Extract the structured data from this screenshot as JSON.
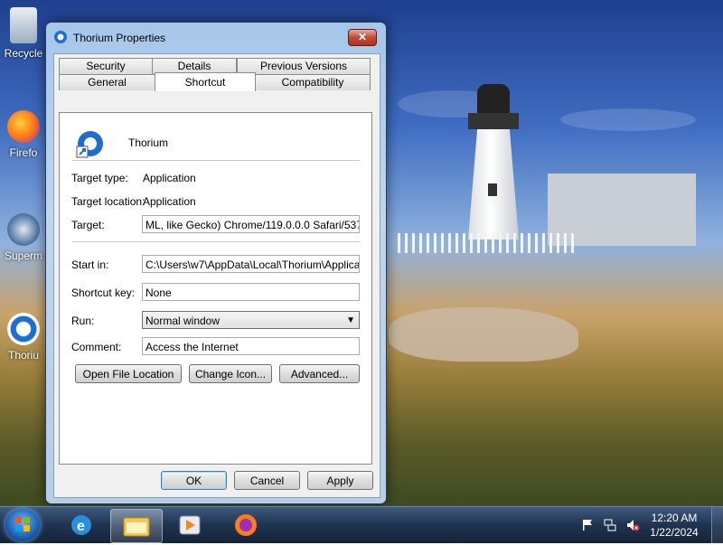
{
  "window": {
    "title": "Thorium Properties",
    "close_label": "✕",
    "tabs_row1": [
      "Security",
      "Details",
      "Previous Versions"
    ],
    "tabs_row2": [
      "General",
      "Shortcut",
      "Compatibility"
    ],
    "active_tab": "Shortcut"
  },
  "shortcut": {
    "app_name": "Thorium",
    "target_type_label": "Target type:",
    "target_type_value": "Application",
    "target_location_label": "Target location:",
    "target_location_value": "Application",
    "target_label": "Target:",
    "target_value": "ML, like Gecko) Chrome/119.0.0.0 Safari/537.36\"",
    "start_in_label": "Start in:",
    "start_in_value": "C:\\Users\\w7\\AppData\\Local\\Thorium\\Application",
    "shortcut_key_label": "Shortcut key:",
    "shortcut_key_value": "None",
    "run_label": "Run:",
    "run_value": "Normal window",
    "comment_label": "Comment:",
    "comment_value": "Access the Internet",
    "open_file_location_label": "Open File Location",
    "change_icon_label": "Change Icon...",
    "advanced_label": "Advanced..."
  },
  "dialog_buttons": {
    "ok": "OK",
    "cancel": "Cancel",
    "apply": "Apply"
  },
  "desktop_icons": [
    {
      "label": "Recycle",
      "icon": "recycle-bin-icon"
    },
    {
      "label": "Firefo",
      "icon": "firefox-icon"
    },
    {
      "label": "Superm",
      "icon": "supermium-icon"
    },
    {
      "label": "Thoriu",
      "icon": "thorium-icon"
    }
  ],
  "taskbar": {
    "pinned": [
      "internet-explorer-icon",
      "file-explorer-icon",
      "media-player-icon",
      "firefox-icon"
    ],
    "time": "12:20 AM",
    "date": "1/22/2024"
  },
  "colors": {
    "accent": "#3c7fb1",
    "close_red": "#c24a36",
    "taskbar": "#1f3350"
  }
}
